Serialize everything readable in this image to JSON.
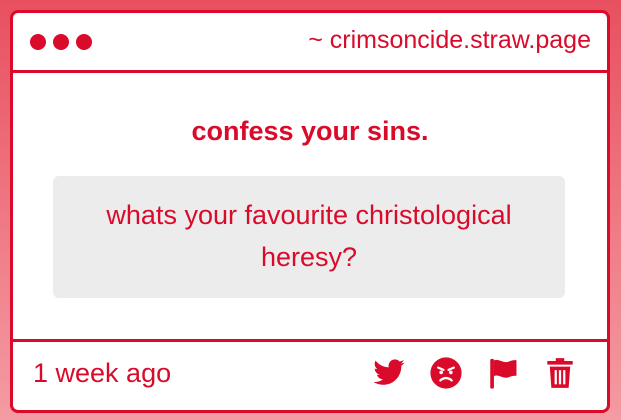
{
  "colors": {
    "accent": "#d90a2a",
    "card_background": "#ffffff",
    "question_background": "#ececec"
  },
  "window": {
    "site_title": "~ crimsoncide.straw.page"
  },
  "main": {
    "prompt": "confess your sins.",
    "question": "whats your favourite christological heresy?"
  },
  "footer": {
    "timestamp": "1 week ago",
    "actions": [
      {
        "icon": "twitter-icon"
      },
      {
        "icon": "angry-face-icon"
      },
      {
        "icon": "flag-icon"
      },
      {
        "icon": "trash-icon"
      }
    ]
  }
}
